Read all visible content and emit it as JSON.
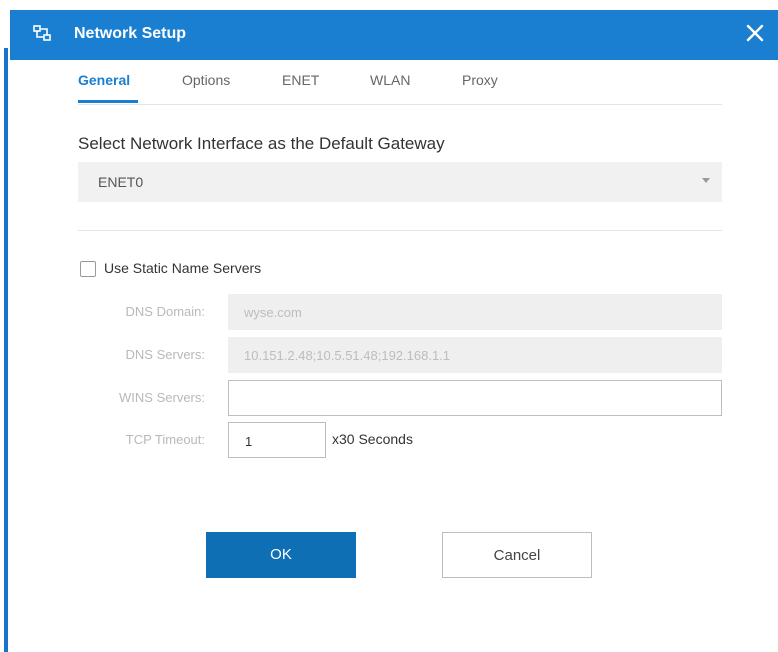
{
  "window": {
    "title": "Network Setup",
    "accent_color": "#1a7fd1",
    "icon": "network-icon",
    "close_icon": "close-icon"
  },
  "tabs": [
    {
      "label": "General",
      "active": true
    },
    {
      "label": "Options",
      "active": false
    },
    {
      "label": "ENET",
      "active": false
    },
    {
      "label": "WLAN",
      "active": false
    },
    {
      "label": "Proxy",
      "active": false
    }
  ],
  "gateway": {
    "label": "Select Network Interface as the Default Gateway",
    "selected": "ENET0"
  },
  "static_dns": {
    "checkbox_label": "Use Static Name Servers",
    "checked": false,
    "fields": {
      "dns_domain": {
        "label": "DNS Domain:",
        "value": "wyse.com",
        "disabled": true
      },
      "dns_servers": {
        "label": "DNS Servers:",
        "value": "10.151.2.48;10.5.51.48;192.168.1.1",
        "disabled": true
      },
      "wins_servers": {
        "label": "WINS Servers:",
        "value": "",
        "disabled": false
      },
      "tcp_timeout": {
        "label": "TCP Timeout:",
        "value": "1",
        "suffix": "x30 Seconds",
        "disabled": false
      }
    }
  },
  "buttons": {
    "ok": "OK",
    "cancel": "Cancel"
  }
}
